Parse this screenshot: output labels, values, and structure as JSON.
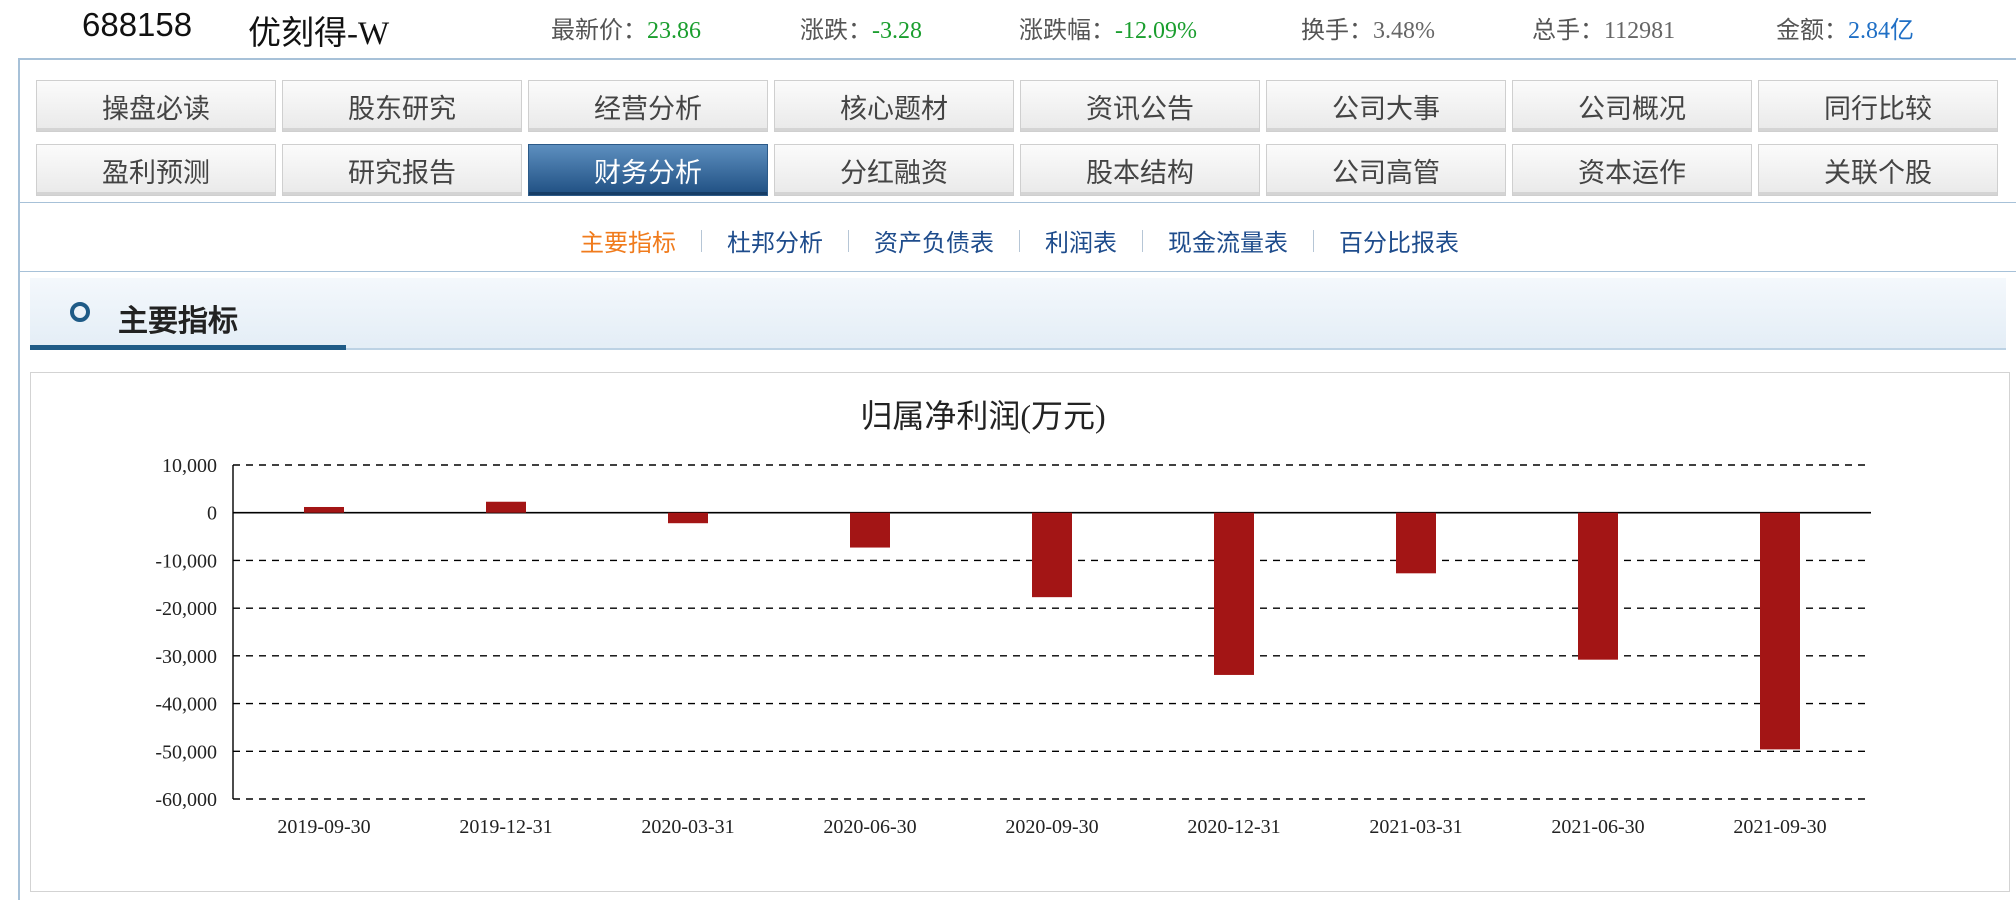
{
  "header": {
    "code": "688158",
    "name": "优刻得-W",
    "stats": [
      {
        "label": "最新价：",
        "value": "23.86",
        "color": "#1a9e2e"
      },
      {
        "label": "涨跌：",
        "value": "-3.28",
        "color": "#1a9e2e"
      },
      {
        "label": "涨跌幅：",
        "value": "-12.09%",
        "color": "#1a9e2e"
      },
      {
        "label": "换手：",
        "value": "3.48%",
        "color": "#666666"
      },
      {
        "label": "总手：",
        "value": "112981",
        "color": "#666666"
      },
      {
        "label": "金额：",
        "value": "2.84亿",
        "color": "#1f6fc5"
      }
    ]
  },
  "tabs": {
    "row1": [
      "操盘必读",
      "股东研究",
      "经营分析",
      "核心题材",
      "资讯公告",
      "公司大事",
      "公司概况",
      "同行比较"
    ],
    "row2": [
      "盈利预测",
      "研究报告",
      "财务分析",
      "分红融资",
      "股本结构",
      "公司高管",
      "资本运作",
      "关联个股"
    ],
    "active": "财务分析",
    "active_color": "#2c5a88"
  },
  "subnav": {
    "items": [
      "主要指标",
      "杜邦分析",
      "资产负债表",
      "利润表",
      "现金流量表",
      "百分比报表"
    ],
    "current": "主要指标",
    "current_color": "#f07b1c",
    "link_color": "#1e4c8c"
  },
  "section": {
    "title": "主要指标"
  },
  "chart_data": {
    "type": "bar",
    "title": "归属净利润(万元)",
    "xlabel": "",
    "ylabel": "",
    "categories": [
      "2019-09-30",
      "2019-12-31",
      "2020-03-31",
      "2020-06-30",
      "2020-09-30",
      "2020-12-31",
      "2021-03-31",
      "2021-06-30",
      "2021-09-30"
    ],
    "values": [
      1200,
      2300,
      -2200,
      -7300,
      -17700,
      -34000,
      -12700,
      -30800,
      -49600
    ],
    "ylim": [
      -60000,
      10000
    ],
    "yticks": [
      10000,
      0,
      -10000,
      -20000,
      -30000,
      -40000,
      -50000,
      -60000
    ],
    "ytick_labels": [
      "10,000",
      "0",
      "-10,000",
      "-20,000",
      "-30,000",
      "-40,000",
      "-50,000",
      "-60,000"
    ],
    "grid": "dashed horizontal",
    "bar_color": "#a31515"
  }
}
